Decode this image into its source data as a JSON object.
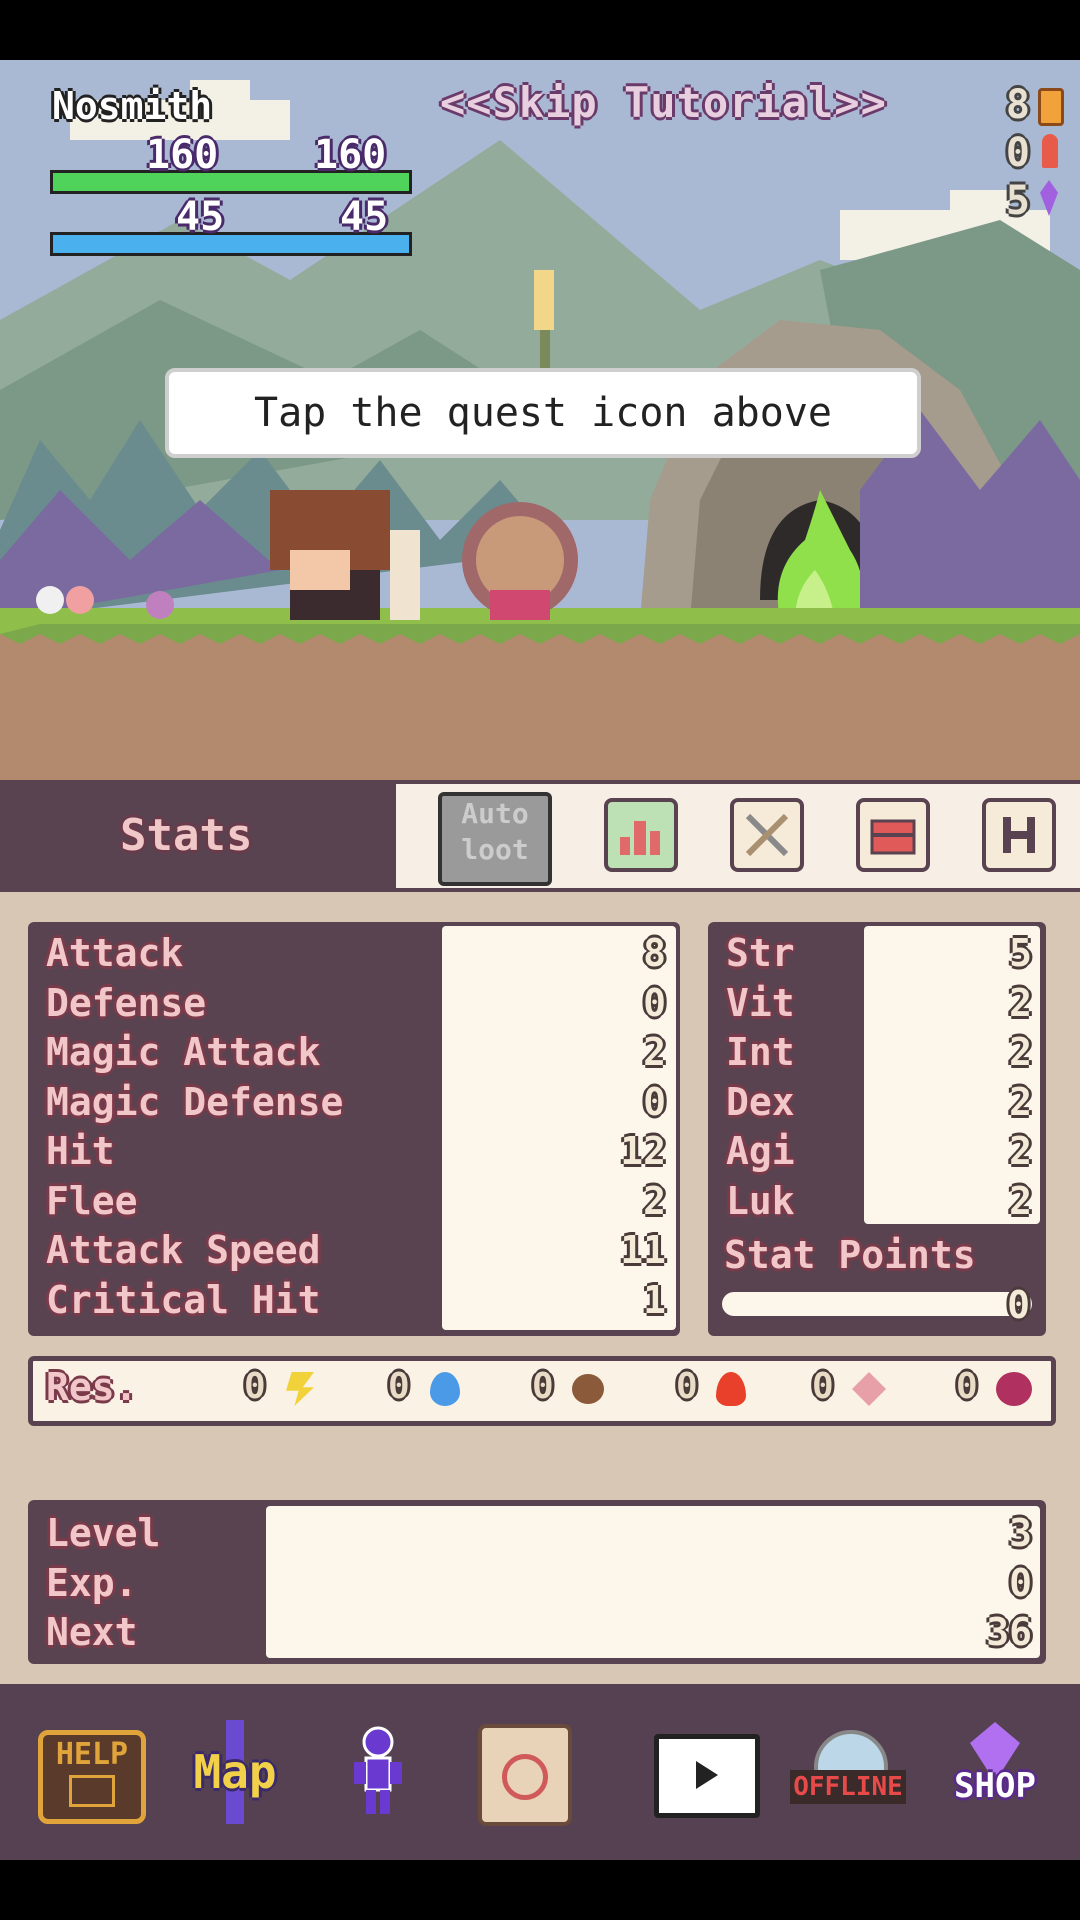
{
  "hud": {
    "player_name": "Nosmith",
    "hp_current": "160",
    "hp_max": "160",
    "mp_current": "45",
    "mp_max": "45",
    "skip_label": "<<Skip Tutorial>>",
    "currency": [
      {
        "value": "8",
        "icon": "gold-coin-icon"
      },
      {
        "value": "0",
        "icon": "rocket-icon"
      },
      {
        "value": "5",
        "icon": "purple-gem-icon"
      }
    ]
  },
  "tutorial_bubble": "Tap the quest icon above",
  "tabs": {
    "title": "Stats",
    "auto_loot_label_1": "Auto",
    "auto_loot_label_2": "loot",
    "icons": [
      "stats-chart-icon",
      "swords-icon",
      "chest-icon",
      "h-icon"
    ]
  },
  "stats": [
    {
      "label": "Attack",
      "value": "8"
    },
    {
      "label": "Defense",
      "value": "0"
    },
    {
      "label": "Magic Attack",
      "value": "2"
    },
    {
      "label": "Magic Defense",
      "value": "0"
    },
    {
      "label": "Hit",
      "value": "12"
    },
    {
      "label": "Flee",
      "value": "2"
    },
    {
      "label": "Attack Speed",
      "value": "11"
    },
    {
      "label": "Critical Hit",
      "value": "1"
    }
  ],
  "attributes": [
    {
      "label": "Str",
      "value": "5"
    },
    {
      "label": "Vit",
      "value": "2"
    },
    {
      "label": "Int",
      "value": "2"
    },
    {
      "label": "Dex",
      "value": "2"
    },
    {
      "label": "Agi",
      "value": "2"
    },
    {
      "label": "Luk",
      "value": "2"
    }
  ],
  "stat_points": {
    "label": "Stat Points",
    "value": "0"
  },
  "resistances": {
    "label": "Res.",
    "items": [
      {
        "value": "0",
        "icon": "lightning-icon"
      },
      {
        "value": "0",
        "icon": "water-drop-icon"
      },
      {
        "value": "0",
        "icon": "earth-icon"
      },
      {
        "value": "0",
        "icon": "fire-icon"
      },
      {
        "value": "0",
        "icon": "holy-icon"
      },
      {
        "value": "0",
        "icon": "dark-icon"
      }
    ]
  },
  "level": [
    {
      "label": "Level",
      "value": "3"
    },
    {
      "label": "Exp.",
      "value": "0"
    },
    {
      "label": "Next",
      "value": "36"
    }
  ],
  "nav": {
    "help_label": "HELP",
    "map_label": "Map",
    "offline_label": "OFFLINE",
    "shop_label": "SHOP"
  },
  "colors": {
    "hp": "#4fd35a",
    "mp": "#4ab0ee",
    "panel": "#5a4350",
    "label_pink": "#f2c7c9"
  }
}
